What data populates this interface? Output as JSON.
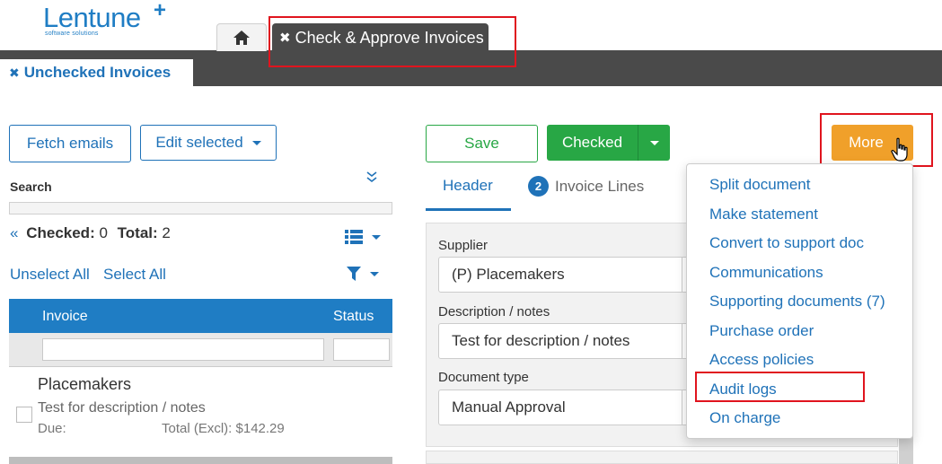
{
  "logo": {
    "name": "Lentune",
    "plus": "+",
    "tagline": "software solutions"
  },
  "tabs": {
    "active_tab_label": "Check & Approve Invoices",
    "close_glyph": "✖",
    "subtab_label": "Unchecked Invoices"
  },
  "toolbar": {
    "fetch_emails": "Fetch emails",
    "edit_selected": "Edit selected",
    "save": "Save",
    "checked": "Checked",
    "more": "More"
  },
  "search": {
    "label": "Search"
  },
  "counts": {
    "checked_label": "Checked:",
    "checked_value": "0",
    "total_label": "Total:",
    "total_value": "2"
  },
  "selection": {
    "unselect_all": "Unselect All",
    "select_all": "Select All"
  },
  "grid": {
    "col_invoice": "Invoice",
    "col_status": "Status",
    "rows": [
      {
        "supplier": "Placemakers",
        "description": "Test for description / notes",
        "due_label": "Due:",
        "total": "Total (Excl): $142.29"
      }
    ]
  },
  "detail_tabs": {
    "header": "Header",
    "invoice_lines_count": "2",
    "invoice_lines": "Invoice Lines"
  },
  "form": {
    "supplier_label": "Supplier",
    "supplier_value": "(P) Placemakers",
    "description_label": "Description / notes",
    "description_value": "Test for description / notes",
    "doctype_label": "Document type",
    "doctype_value": "Manual Approval"
  },
  "more_menu": [
    "Split document",
    "Make statement",
    "Convert to support doc",
    "Communications",
    "Supporting documents (7)",
    "Purchase order",
    "Access policies",
    "Audit logs",
    "On charge"
  ],
  "colors": {
    "primary": "#1f72b8",
    "topbar": "#4a4a4a",
    "checked_green": "#28a745",
    "more_orange": "#f0a02a",
    "highlight_red": "#e0141e"
  }
}
